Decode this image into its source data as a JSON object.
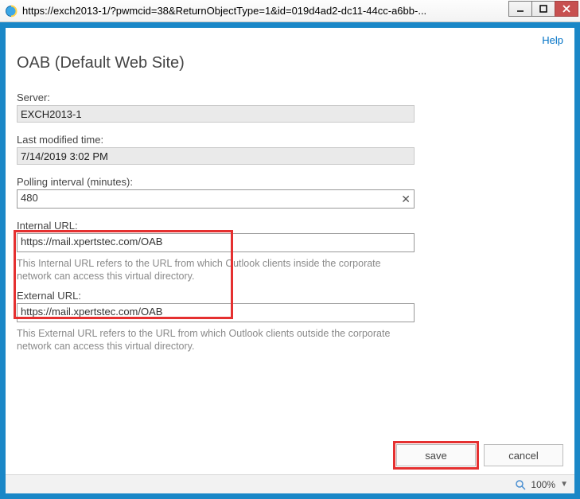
{
  "window": {
    "url": "https://exch2013-1/?pwmcid=38&ReturnObjectType=1&id=019d4ad2-dc11-44cc-a6bb-..."
  },
  "header": {
    "help_label": "Help",
    "page_title": "OAB (Default Web Site)"
  },
  "fields": {
    "server_label": "Server:",
    "server_value": "EXCH2013-1",
    "last_modified_label": "Last modified time:",
    "last_modified_value": "7/14/2019 3:02 PM",
    "polling_label": "Polling interval (minutes):",
    "polling_value": "480",
    "internal_url_label": "Internal URL:",
    "internal_url_value": "https://mail.xpertstec.com/OAB",
    "internal_url_help": "This Internal URL refers to the URL from which Outlook clients inside the corporate network can access this virtual directory.",
    "external_url_label": "External URL:",
    "external_url_value": "https://mail.xpertstec.com/OAB",
    "external_url_help": "This External URL refers to the URL from which Outlook clients outside the corporate network can access this virtual directory."
  },
  "buttons": {
    "save": "save",
    "cancel": "cancel"
  },
  "status": {
    "zoom": "100%"
  }
}
